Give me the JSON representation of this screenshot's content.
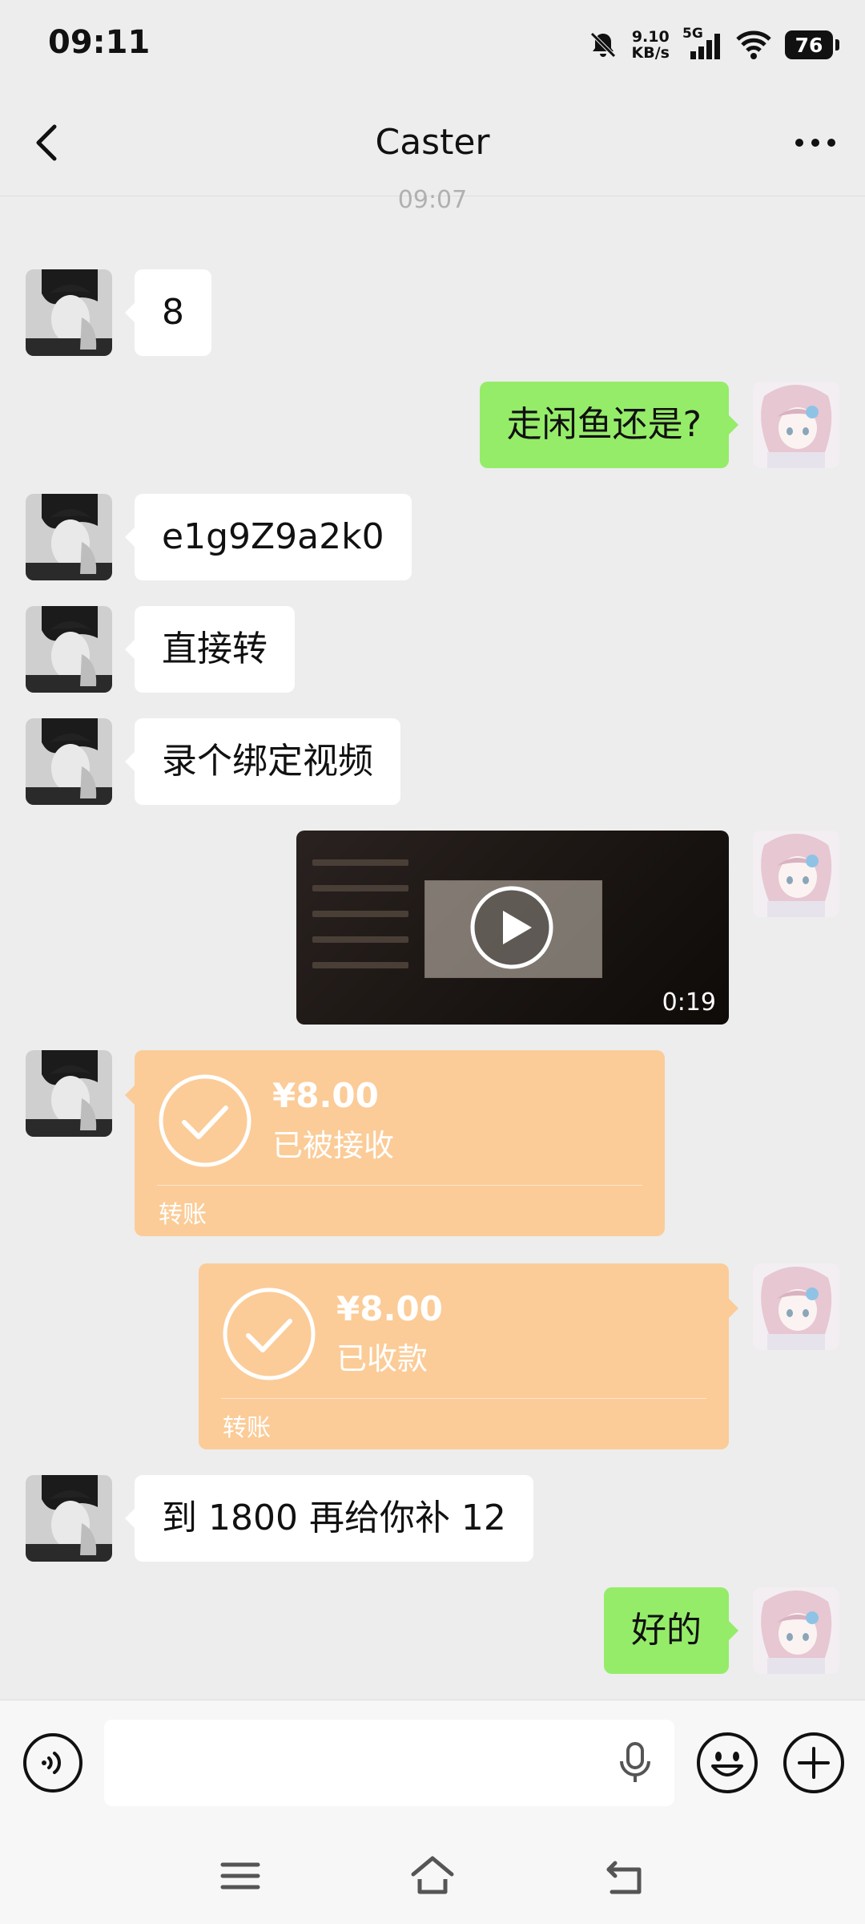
{
  "status_bar": {
    "time": "09:11",
    "net_speed_value": "9.10",
    "net_speed_unit": "KB/s",
    "network_type": "5G",
    "battery_level": "76",
    "icons": [
      "bell-muted-icon",
      "signal-icon",
      "wifi-icon",
      "battery-icon"
    ]
  },
  "header": {
    "title": "Caster",
    "back_icon": "chevron-left-icon",
    "more_icon": "more-dots-icon"
  },
  "chat": {
    "timestamp": "09:07",
    "messages": [
      {
        "side": "in",
        "type": "text",
        "text": "8"
      },
      {
        "side": "out",
        "type": "text",
        "text": "走闲鱼还是?"
      },
      {
        "side": "in",
        "type": "text",
        "text": "e1g9Z9a2k0"
      },
      {
        "side": "in",
        "type": "text",
        "text": "直接转"
      },
      {
        "side": "in",
        "type": "text",
        "text": "录个绑定视频"
      },
      {
        "side": "out",
        "type": "video",
        "duration": "0:19"
      },
      {
        "side": "in",
        "type": "transfer",
        "amount": "¥8.00",
        "status": "已被接收",
        "label": "转账"
      },
      {
        "side": "out",
        "type": "transfer",
        "amount": "¥8.00",
        "status": "已收款",
        "label": "转账"
      },
      {
        "side": "in",
        "type": "text",
        "text": "到 1800 再给你补 12"
      },
      {
        "side": "out",
        "type": "text",
        "text": "好的"
      }
    ]
  },
  "input_bar": {
    "placeholder": "",
    "icons": [
      "voice-icon",
      "mic-icon",
      "emoji-icon",
      "plus-icon"
    ]
  },
  "nav_bar": {
    "icons": [
      "menu-icon",
      "home-icon",
      "back-icon"
    ]
  },
  "colors": {
    "background": "#ededed",
    "incoming_bubble": "#ffffff",
    "outgoing_bubble": "#95ec69",
    "transfer_card": "#fbcc98"
  }
}
